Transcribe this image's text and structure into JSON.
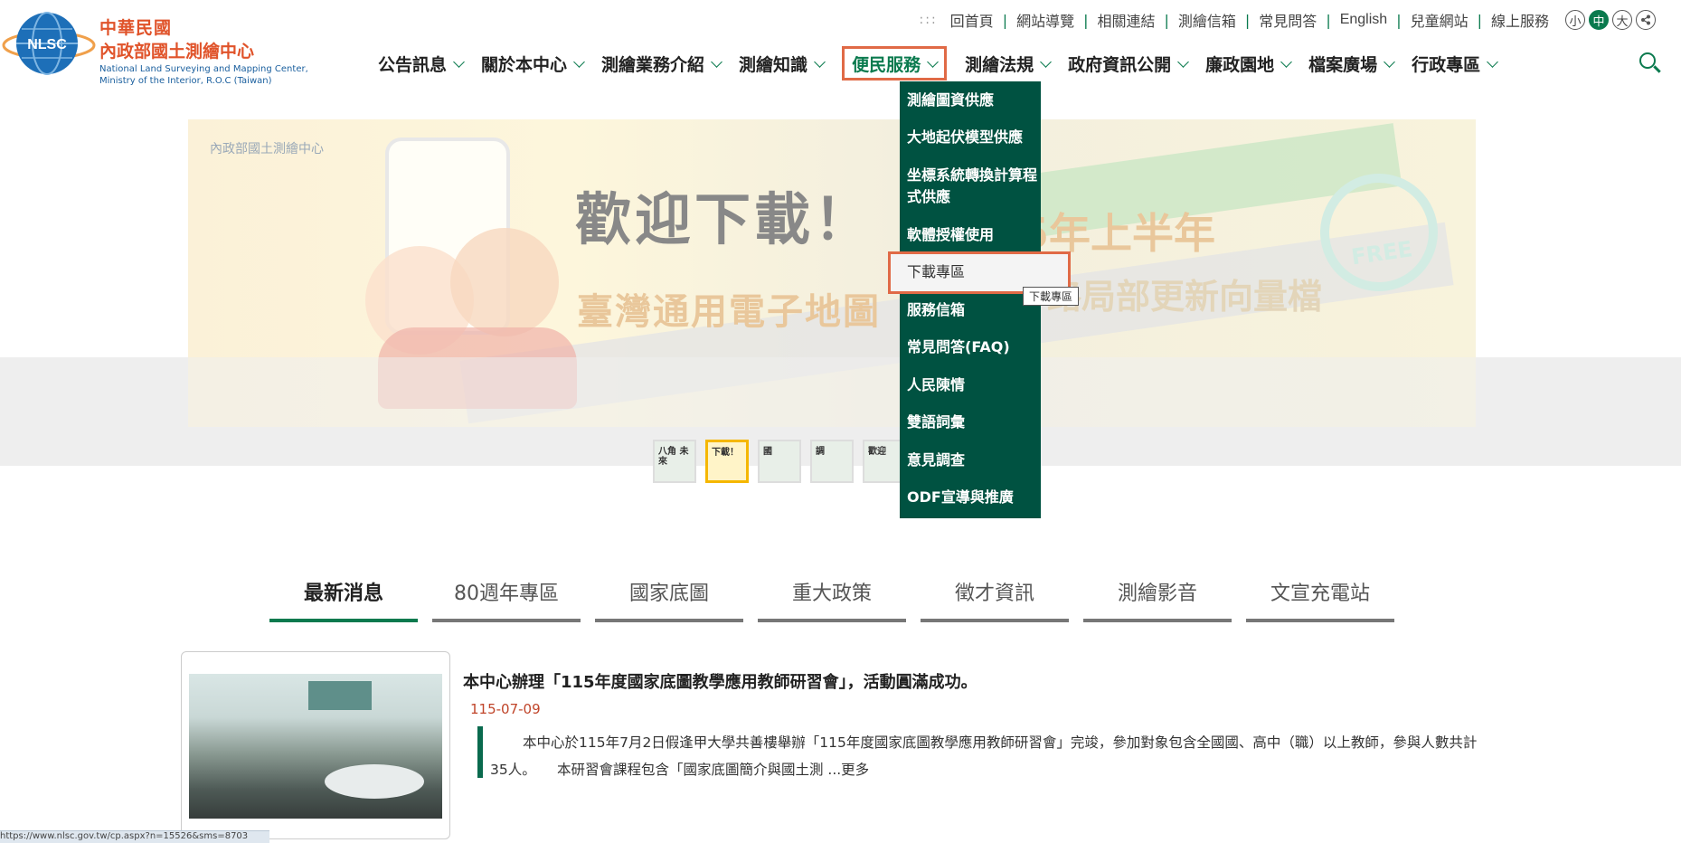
{
  "logo": {
    "badge": "NLSC",
    "line1": "中華民國",
    "line2": "內政部國土測繪中心",
    "en_line1": "National Land Surveying and Mapping Center,",
    "en_line2": "Ministry of the Interior, R.O.C (Taiwan)"
  },
  "top_links": {
    "dots": ":::",
    "home": "回首頁",
    "sitemap": "網站導覽",
    "links": "相關連結",
    "mailbox": "測繪信箱",
    "faq": "常見問答",
    "english": "English",
    "kids": "兒童網站",
    "online": "線上服務",
    "font_small": "小",
    "font_medium": "中",
    "font_large": "大"
  },
  "main_nav": [
    {
      "label": "公告訊息"
    },
    {
      "label": "關於本中心"
    },
    {
      "label": "測繪業務介紹"
    },
    {
      "label": "測繪知識"
    },
    {
      "label": "便民服務"
    },
    {
      "label": "測繪法規"
    },
    {
      "label": "政府資訊公開"
    },
    {
      "label": "廉政園地"
    },
    {
      "label": "檔案廣場"
    },
    {
      "label": "行政專區"
    }
  ],
  "dropdown": {
    "items": [
      {
        "label": "測繪圖資供應"
      },
      {
        "label": "大地起伏模型供應"
      },
      {
        "label": "坐標系統轉換計算程式供應"
      },
      {
        "label": "軟體授權使用"
      },
      {
        "label": "下載專區"
      },
      {
        "label": "服務信箱"
      },
      {
        "label": "常見問答(FAQ)"
      },
      {
        "label": "人民陳情"
      },
      {
        "label": "雙語詞彙"
      },
      {
        "label": "意見調查"
      },
      {
        "label": "ODF宣導與推廣"
      }
    ],
    "tooltip": "下載專區"
  },
  "banner": {
    "brand": "內政部國土測繪中心",
    "headline": "歡迎下載！",
    "subtitle": "臺灣通用電子地圖",
    "right_title": "5年上半年",
    "right_sub": "路局部更新向量檔",
    "free": "FREE"
  },
  "thumbnails": [
    {
      "label": "八角 未來"
    },
    {
      "label": "下載！"
    },
    {
      "label": "國"
    },
    {
      "label": "調"
    },
    {
      "label": "歡迎"
    }
  ],
  "tabs": [
    {
      "label": "最新消息"
    },
    {
      "label": "80週年專區"
    },
    {
      "label": "國家底圖"
    },
    {
      "label": "重大政策"
    },
    {
      "label": "徵才資訊"
    },
    {
      "label": "測繪影音"
    },
    {
      "label": "文宣充電站"
    }
  ],
  "news": {
    "title": "本中心辦理「115年度國家底圖教學應用教師研習會」，活動圓滿成功。",
    "date": "115-07-09",
    "body": "本中心於115年7月2日假逢甲大學共善樓舉辦「115年度國家底圖教學應用教師研習會」完竣，參加對象包含全國國、高中（職）以上教師，參與人數共計35人。　　本研習會課程包含「國家底圖簡介與國土測 ...更多"
  },
  "statusbar": "https://www.nlsc.gov.tw/cp.aspx?n=15526&sms=8703",
  "colors": {
    "brand_green": "#0a7a4e",
    "dropdown_bg": "#005241",
    "highlight": "#e06a46",
    "date_red": "#c0452a"
  }
}
